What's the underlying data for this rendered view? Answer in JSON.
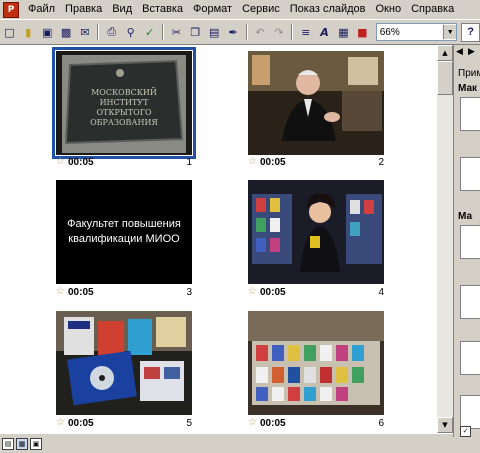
{
  "menu": {
    "app_icon_text": "P",
    "items": [
      "Файл",
      "Правка",
      "Вид",
      "Вставка",
      "Формат",
      "Сервис",
      "Показ слайдов",
      "Окно",
      "Справка"
    ]
  },
  "toolbar": {
    "zoom_value": "66%",
    "help_label": "?"
  },
  "slides": [
    {
      "number": "1",
      "time": "00:05",
      "text_lines": [
        "МОСКОВСКИЙ",
        "ИНСТИТУТ",
        "ОТКРЫТОГО",
        "ОБРАЗОВАНИЯ"
      ]
    },
    {
      "number": "2",
      "time": "00:05"
    },
    {
      "number": "3",
      "time": "00:05",
      "text_lines": [
        "Факультет повышения",
        "квалификации МИОО"
      ]
    },
    {
      "number": "4",
      "time": "00:05"
    },
    {
      "number": "5",
      "time": "00:05"
    },
    {
      "number": "6",
      "time": "00:05"
    }
  ],
  "task_pane": {
    "title": "Прим",
    "heading_1": "Мак",
    "heading_2": "Ма"
  },
  "colors": {
    "selection": "#2050a8",
    "caption": "#ff5050"
  }
}
